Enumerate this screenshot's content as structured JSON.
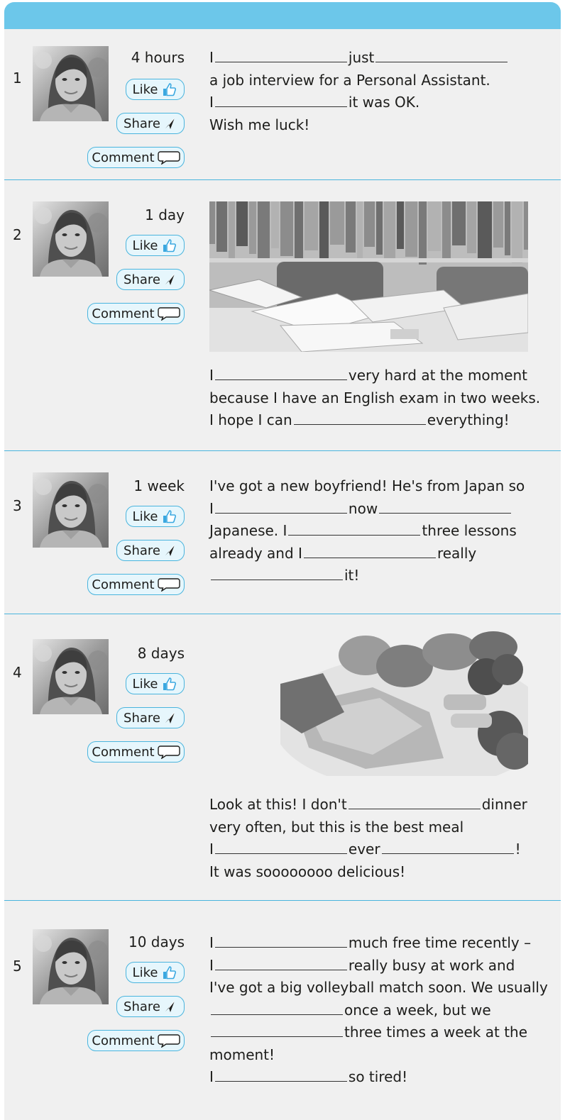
{
  "posts": [
    {
      "number": "1",
      "time": "4 hours",
      "like_label": "Like",
      "share_label": "Share",
      "comment_label": "Comment",
      "lines": [
        [
          "I",
          "",
          "just",
          ""
        ],
        [
          "a job interview for a Personal Assistant."
        ],
        [
          "I",
          "",
          "it was OK."
        ],
        [
          "Wish me luck!"
        ]
      ]
    },
    {
      "number": "2",
      "time": "1 day",
      "like_label": "Like",
      "share_label": "Share",
      "comment_label": "Comment",
      "lines": [
        [
          "I",
          "",
          "very hard at the moment"
        ],
        [
          "because I have an English exam in two weeks."
        ],
        [
          "I hope I can",
          "",
          "everything!"
        ]
      ]
    },
    {
      "number": "3",
      "time": "1 week",
      "like_label": "Like",
      "share_label": "Share",
      "comment_label": "Comment",
      "lines": [
        [
          "I've got a new boyfriend! He's from Japan so"
        ],
        [
          "I",
          "",
          "now",
          ""
        ],
        [
          "Japanese. I",
          "",
          "three lessons"
        ],
        [
          "already and I",
          "",
          "really"
        ],
        [
          "",
          "it!"
        ]
      ]
    },
    {
      "number": "4",
      "time": "8 days",
      "like_label": "Like",
      "share_label": "Share",
      "comment_label": "Comment",
      "lines": [
        [
          "Look at this! I don't",
          "",
          "dinner"
        ],
        [
          "very often, but this is the best meal"
        ],
        [
          "I",
          "",
          "ever",
          "",
          "!"
        ],
        [
          "It was soooooooo delicious!"
        ]
      ]
    },
    {
      "number": "5",
      "time": "10 days",
      "like_label": "Like",
      "share_label": "Share",
      "comment_label": "Comment",
      "lines": [
        [
          "I",
          "",
          "much free time recently –"
        ],
        [
          "I",
          "",
          "really busy at work and"
        ],
        [
          "I've got a big volleyball match soon. We usually"
        ],
        [
          "",
          "once a week, but we"
        ],
        [
          "",
          "three times a week at the"
        ],
        [
          "moment!"
        ],
        [
          "I",
          "",
          "so tired!"
        ]
      ]
    }
  ],
  "icons": {
    "like": "thumbs-up-icon",
    "share": "send-arrow-icon",
    "comment": "speech-bubble-icon"
  },
  "colors": {
    "accent": "#49b4dd",
    "header_bar": "#6cc7ea",
    "button_fill": "#e6f6fc",
    "like_icon": "#3aa8e0",
    "background": "#f0f0f0"
  }
}
